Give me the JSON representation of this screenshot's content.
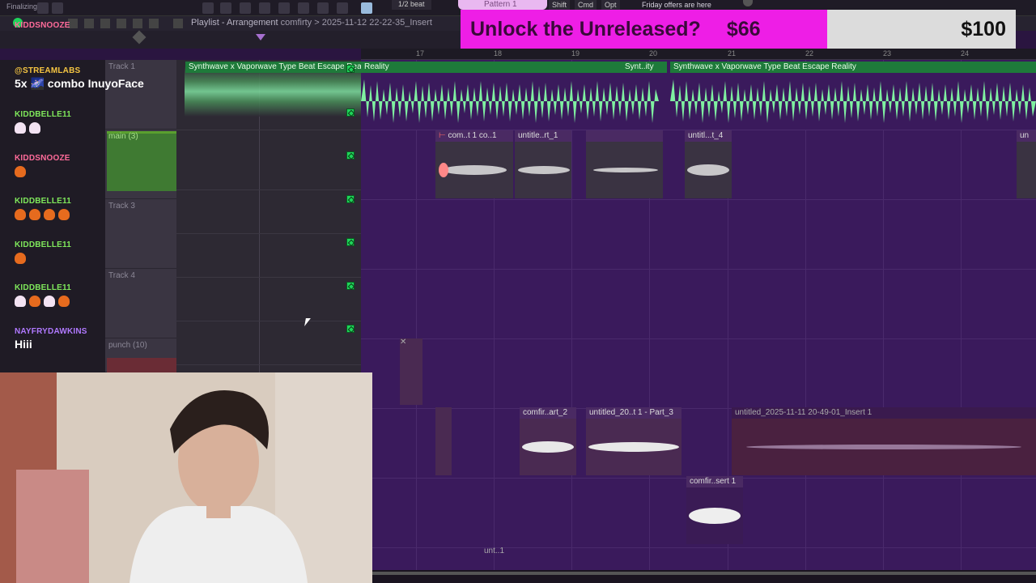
{
  "toolbar": {
    "app_label": "Finalizing",
    "beat_label": "1/2 beat",
    "pattern_label": "Pattern 1",
    "shortcuts": [
      "Shift",
      "Cmd",
      "Opt"
    ],
    "promo_text": "Friday offers are here"
  },
  "playlist": {
    "title": "Playlist - Arrangement",
    "file": "comfirty > 2025-11-12 22-22-35_Insert"
  },
  "banner": {
    "headline": "Unlock the Unreleased?",
    "current_amount": "$66",
    "goal_amount": "$100"
  },
  "ruler": {
    "bars": [
      "17",
      "18",
      "19",
      "20",
      "21",
      "22",
      "23",
      "24"
    ]
  },
  "tracks": [
    {
      "label": "Track 1"
    },
    {
      "label": "main (3)"
    },
    {
      "label": "Track 3"
    },
    {
      "label": "Track 4"
    },
    {
      "label": "punch (10)"
    }
  ],
  "clips": {
    "top_1": "Synthwave x Vaporwave Type Beat Escape Reality",
    "top_2": "Synt..ity",
    "top_3": "Synthwave x Vaporwave Type Beat Escape Reality",
    "row2_a": "com..t 1",
    "row2_b": "co..1",
    "row2_c": "untitle..rt_1",
    "row2_d": "untitl...t_4",
    "row2_e": "un",
    "row5_a": "comfir..art_2",
    "row5_b": "untitled_20..t 1 - Part_3",
    "row5_c": "untitled_2025-11-11 20-49-01_Insert 1",
    "row6_a": "comfir..sert 1",
    "row7_a": "unt..1"
  },
  "chat": {
    "first_user": "KIDDSNOOZE",
    "messages": [
      {
        "user": "@STREAMLABS",
        "text": "5x 🌌 combo InuyoFace",
        "color": "#f5c542"
      },
      {
        "user": "KIDDBELLE11",
        "text": "",
        "emotes": [
          "heart",
          "heart"
        ],
        "color": "#7fe85b"
      },
      {
        "user": "KIDDSNOOZE",
        "text": "",
        "emotes": [
          "fire"
        ],
        "color": "#ff6b9a"
      },
      {
        "user": "KIDDBELLE11",
        "text": "",
        "emotes": [
          "fire",
          "fire",
          "fire",
          "fire"
        ],
        "color": "#7fe85b"
      },
      {
        "user": "KIDDBELLE11",
        "text": "",
        "emotes": [
          "fire"
        ],
        "color": "#7fe85b"
      },
      {
        "user": "KIDDBELLE11",
        "text": "",
        "emotes": [
          "heart",
          "fire",
          "heart",
          "fire"
        ],
        "color": "#7fe85b"
      },
      {
        "user": "NAYFRYDAWKINS",
        "text": "Hiii",
        "color": "#b079ff"
      }
    ]
  },
  "colors": {
    "grid_bg": "#3a1a5c",
    "waveform_green": "#7ff0a0",
    "banner_magenta": "#ee1ee6",
    "banner_grey": "#dcdcdc"
  }
}
